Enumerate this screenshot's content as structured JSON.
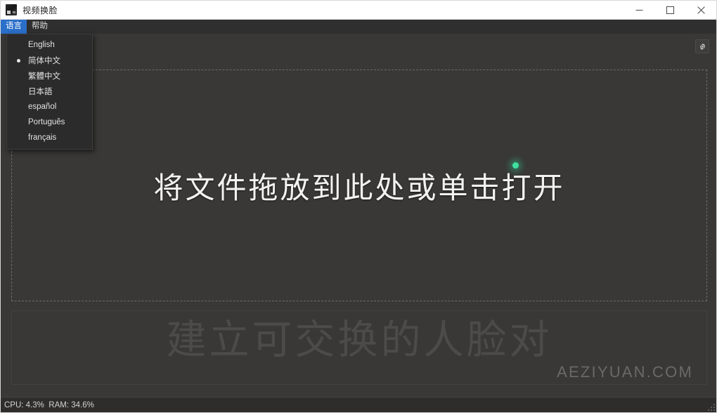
{
  "window": {
    "title": "视频换脸",
    "icon": "app-icon",
    "controls": {
      "minimize": "minimize-icon",
      "maximize": "maximize-icon",
      "close": "close-icon"
    }
  },
  "menubar": {
    "items": [
      {
        "label": "语言",
        "active": true
      },
      {
        "label": "帮助",
        "active": false
      }
    ]
  },
  "language_menu": {
    "open": true,
    "items": [
      {
        "label": "English",
        "checked": false
      },
      {
        "label": "简体中文",
        "checked": true
      },
      {
        "label": "繁體中文",
        "checked": false
      },
      {
        "label": "日本語",
        "checked": false
      },
      {
        "label": "español",
        "checked": false
      },
      {
        "label": "Português",
        "checked": false
      },
      {
        "label": "français",
        "checked": false
      }
    ]
  },
  "content": {
    "settings_icon": "gear-icon",
    "drop_zone_text": "将文件拖放到此处或单击打开",
    "watermark_text": "建立可交换的人脸对",
    "watermark_site": "AEZIYUAN.COM"
  },
  "status_bar": {
    "text": "CPU: 4.3%  RAM: 34.6%",
    "cpu_label": "CPU",
    "cpu_value": "4.3%",
    "ram_label": "RAM",
    "ram_value": "34.6%"
  },
  "colors": {
    "window_background": "#393836",
    "titlebar_background": "#ffffff",
    "menubar_background": "#2f2f2f",
    "menu_highlight": "#2a6fc9",
    "dropdown_background": "#2b2b2b",
    "dashed_border": "#6d6c69",
    "statusbar_background": "#2e2d2c",
    "cursor_dot": "#3fe0a0",
    "watermark": "#4c4b49"
  }
}
